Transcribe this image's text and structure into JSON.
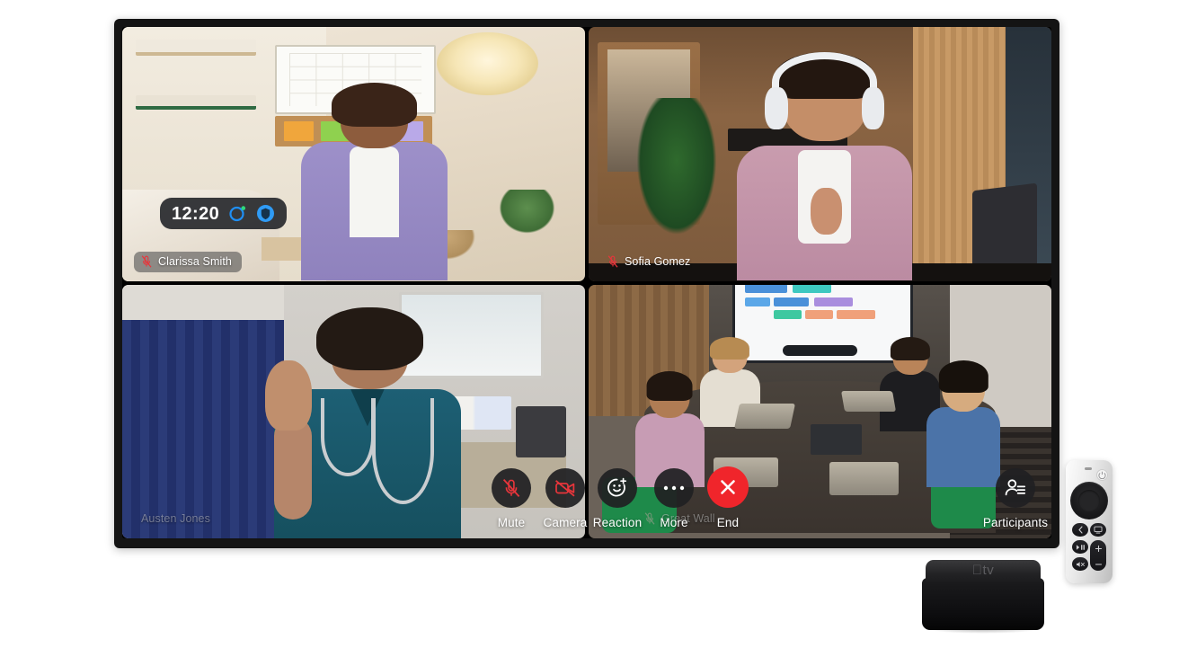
{
  "device": {
    "tv_label": "apple-tv-screen",
    "set_top_box_logo": "tv",
    "remote_buttons": [
      {
        "name": "power-button",
        "icon": "power-icon"
      },
      {
        "name": "touchpad",
        "icon": "clickpad-icon"
      },
      {
        "name": "back-button",
        "icon": "chevron-left-icon"
      },
      {
        "name": "tv-home-button",
        "icon": "tv-icon"
      },
      {
        "name": "play-pause-button",
        "icon": "play-pause-icon"
      },
      {
        "name": "mute-button",
        "icon": "speaker-mute-icon"
      },
      {
        "name": "volume-up",
        "icon": "plus-icon"
      },
      {
        "name": "volume-down",
        "icon": "minus-icon"
      }
    ]
  },
  "call": {
    "status_pill": {
      "time": "12:20",
      "recording_icon": "recording-ring-icon",
      "encryption_icon": "shield-lock-icon"
    },
    "participants": [
      {
        "name": "Clarissa Smith",
        "muted": true,
        "mic_icon": "mic-off-icon",
        "tag_style": "filled"
      },
      {
        "name": "Sofia Gomez",
        "muted": true,
        "mic_icon": "mic-off-icon",
        "tag_style": "plain"
      },
      {
        "name": "Austen Jones",
        "muted": false,
        "mic_icon": "",
        "tag_style": "dim"
      },
      {
        "name": "Great Wall",
        "muted": true,
        "mic_icon": "mic-off-icon",
        "tag_style": "dim"
      }
    ],
    "controls": [
      {
        "label": "Mute",
        "icon": "mic-off-icon",
        "state": "active",
        "accent": "#f0252b"
      },
      {
        "label": "Camera",
        "icon": "camera-off-icon",
        "state": "active",
        "accent": "#f0252b"
      },
      {
        "label": "Reaction",
        "icon": "reaction-add-icon",
        "state": "default",
        "accent": "#ffffff"
      },
      {
        "label": "More",
        "icon": "ellipsis-icon",
        "state": "default",
        "accent": "#ffffff"
      },
      {
        "label": "End",
        "icon": "close-x-icon",
        "state": "danger",
        "accent": "#ffffff"
      },
      {
        "label": "Participants",
        "icon": "participants-icon",
        "state": "default",
        "accent": "#ffffff"
      }
    ]
  },
  "colors": {
    "end_red": "#f0252b",
    "muted_red": "#e8353b",
    "pill_bg": "rgba(30,32,36,0.88)",
    "control_bg": "rgba(32,32,34,0.93)",
    "accent_blue": "#1f8ff5",
    "bezel": "#141414"
  }
}
